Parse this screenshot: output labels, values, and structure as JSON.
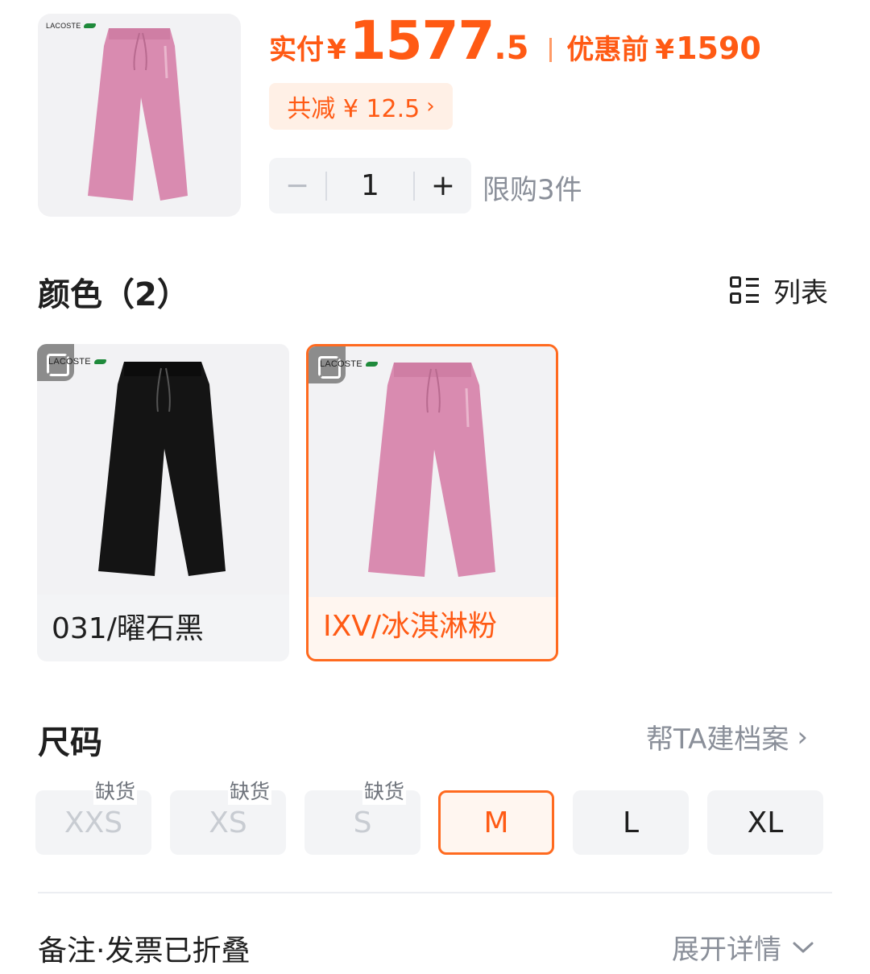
{
  "product": {
    "brand": "LACOSTE",
    "pay_label": "实付",
    "currency": "¥",
    "price_int": "1577",
    "price_dec": ".5",
    "original_label": "优惠前",
    "original_price": "1590",
    "discount_text": "共减 ¥ 12.5",
    "quantity_minus": "−",
    "quantity": "1",
    "quantity_plus": "+",
    "limit_text": "限购3件"
  },
  "color_section": {
    "title": "颜色（2）",
    "view_toggle_label": "列表",
    "options": [
      {
        "label": "031/曜石黑",
        "selected": false,
        "color": "#1b1b1b"
      },
      {
        "label": "IXV/冰淇淋粉",
        "selected": true,
        "color": "#d98bb0"
      }
    ]
  },
  "size_section": {
    "title": "尺码",
    "profile_link": "帮TA建档案",
    "out_of_stock_label": "缺货",
    "sizes": [
      {
        "label": "XXS",
        "status": "out"
      },
      {
        "label": "XS",
        "status": "out"
      },
      {
        "label": "S",
        "status": "out"
      },
      {
        "label": "M",
        "status": "selected"
      },
      {
        "label": "L",
        "status": "available"
      },
      {
        "label": "XL",
        "status": "available"
      }
    ]
  },
  "footer": {
    "note_label": "备注·发票已折叠",
    "expand_label": "展开详情"
  },
  "colors": {
    "accent": "#ff5a14",
    "accent_border": "#ff6a1f",
    "muted": "#8a8f99"
  }
}
